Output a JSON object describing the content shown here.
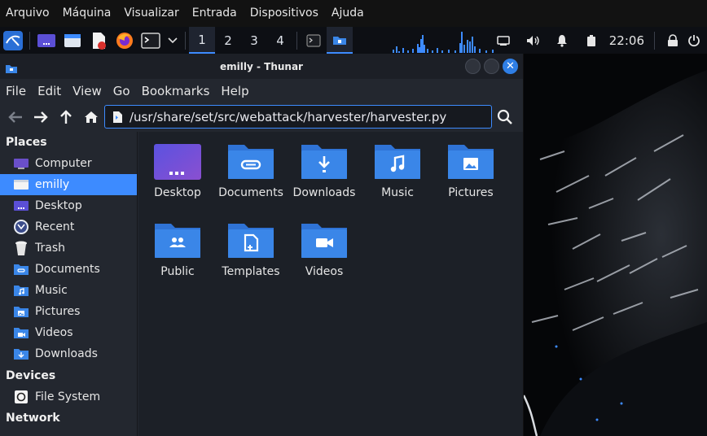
{
  "vm_menu": [
    "Arquivo",
    "Máquina",
    "Visualizar",
    "Entrada",
    "Dispositivos",
    "Ajuda"
  ],
  "panel": {
    "workspaces": [
      "1",
      "2",
      "3",
      "4"
    ],
    "clock": "22:06"
  },
  "window": {
    "title": "emilly - Thunar",
    "menu": [
      "File",
      "Edit",
      "View",
      "Go",
      "Bookmarks",
      "Help"
    ],
    "location": "/usr/share/set/src/webattack/harvester/harvester.py"
  },
  "sidebar": {
    "places_header": "Places",
    "places": [
      {
        "label": "Computer",
        "icon": "computer-icon"
      },
      {
        "label": "emilly",
        "icon": "home-icon"
      },
      {
        "label": "Desktop",
        "icon": "desktop-icon"
      },
      {
        "label": "Recent",
        "icon": "recent-icon"
      },
      {
        "label": "Trash",
        "icon": "trash-icon"
      },
      {
        "label": "Documents",
        "icon": "documents-icon"
      },
      {
        "label": "Music",
        "icon": "music-icon"
      },
      {
        "label": "Pictures",
        "icon": "pictures-icon"
      },
      {
        "label": "Videos",
        "icon": "videos-icon"
      },
      {
        "label": "Downloads",
        "icon": "downloads-icon"
      }
    ],
    "devices_header": "Devices",
    "devices": [
      {
        "label": "File System",
        "icon": "drive-icon"
      }
    ],
    "network_header": "Network"
  },
  "folders": [
    {
      "label": "Desktop",
      "icon": "desktop-folder-icon"
    },
    {
      "label": "Documents",
      "icon": "documents-folder-icon"
    },
    {
      "label": "Downloads",
      "icon": "downloads-folder-icon"
    },
    {
      "label": "Music",
      "icon": "music-folder-icon"
    },
    {
      "label": "Pictures",
      "icon": "pictures-folder-icon"
    },
    {
      "label": "Public",
      "icon": "public-folder-icon"
    },
    {
      "label": "Templates",
      "icon": "templates-folder-icon"
    },
    {
      "label": "Videos",
      "icon": "videos-folder-icon"
    }
  ],
  "colors": {
    "accent": "#3d8bff",
    "folder": "#3a86e8",
    "window_bg": "#23272f",
    "content_bg": "#1c2027"
  }
}
